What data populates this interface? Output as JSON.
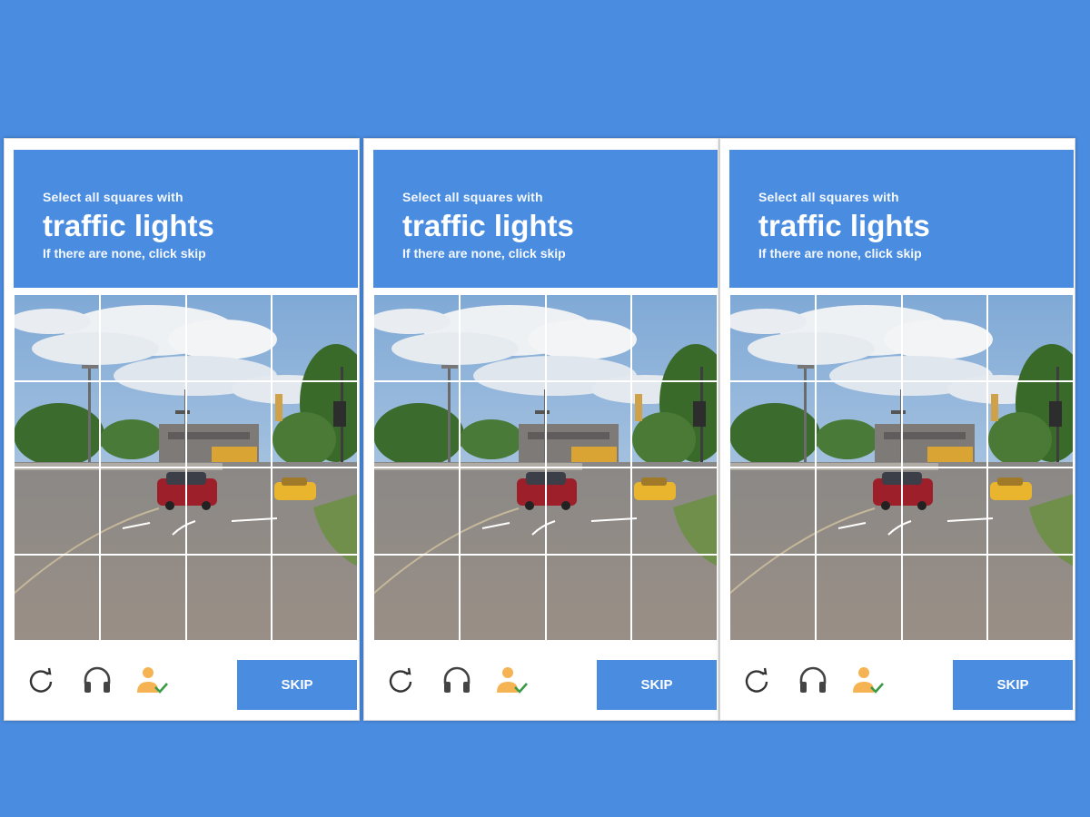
{
  "colors": {
    "brand_blue": "#4a8ce0",
    "background": "#4a8ce0",
    "car_red": "#9c1f2a",
    "car_yellow": "#e9b52f"
  },
  "challenges": [
    {
      "instruction": "Select all squares with",
      "target": "traffic lights",
      "hint": "If there are none, click skip",
      "grid": {
        "rows": 4,
        "cols": 4
      },
      "icons": {
        "reload": "reload-icon",
        "audio": "headphones-icon",
        "info": "person-check-icon"
      },
      "button_label": "SKIP"
    },
    {
      "instruction": "Select all squares with",
      "target": "traffic lights",
      "hint": "If there are none, click skip",
      "grid": {
        "rows": 4,
        "cols": 4
      },
      "icons": {
        "reload": "reload-icon",
        "audio": "headphones-icon",
        "info": "person-check-icon"
      },
      "button_label": "SKIP"
    },
    {
      "instruction": "Select all squares with",
      "target": "traffic lights",
      "hint": "If there are none, click skip",
      "grid": {
        "rows": 4,
        "cols": 4
      },
      "icons": {
        "reload": "reload-icon",
        "audio": "headphones-icon",
        "info": "person-check-icon"
      },
      "button_label": "SKIP"
    }
  ]
}
